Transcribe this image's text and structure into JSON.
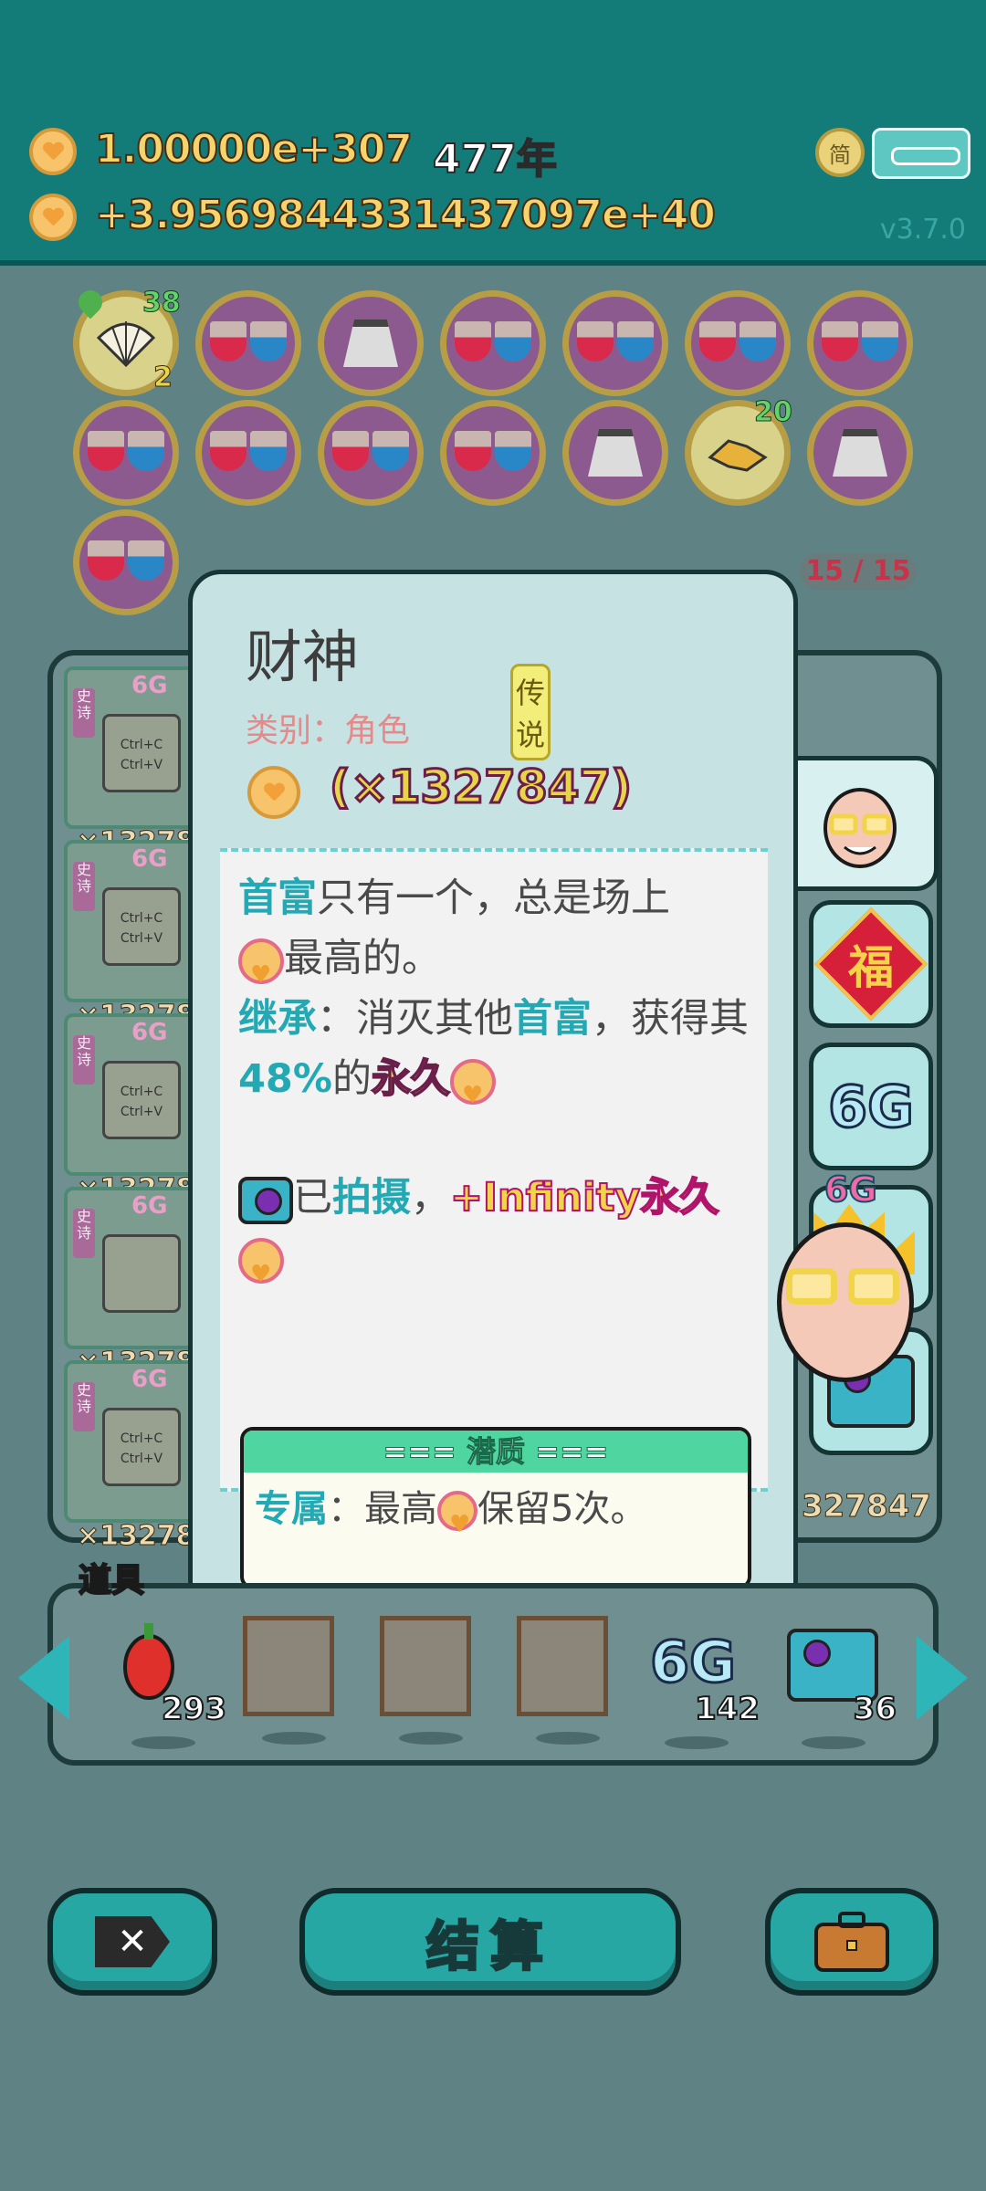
{
  "top": {
    "gold_total": "1.00000e+307",
    "year": "477年",
    "gold_rate": "+3.9569844331437097e+40",
    "lang_button": "简",
    "version": "v3.7.0"
  },
  "badges": {
    "row1_counts": [
      "38",
      "2"
    ],
    "row2_count": "20",
    "slots": "15 / 15"
  },
  "cards": [
    {
      "tag": "史诗",
      "label": "6G",
      "box": "Ctrl+C\nCtrl+V",
      "mult": "×13278"
    },
    {
      "tag": "史诗",
      "label": "6G",
      "box": "Ctrl+C\nCtrl+V",
      "mult": "×13278"
    },
    {
      "tag": "史诗",
      "label": "6G",
      "box": "Ctrl+C\nCtrl+V",
      "mult": "×13278"
    },
    {
      "tag": "史诗",
      "label": "6G",
      "box": "",
      "mult": "×13278"
    },
    {
      "tag": "史诗",
      "label": "6G",
      "box": "Ctrl+C\nCtrl+V",
      "mult": "×13278"
    }
  ],
  "right_col_mult": "327847",
  "popup": {
    "name": "财神",
    "category": "类别：角色",
    "rarity": "传说",
    "crown_label": "6G",
    "multiplier": "(×1327847)",
    "desc1_kw": "首富",
    "desc1_rest": "只有一个，总是场上",
    "desc1_end": "最高的。",
    "desc2_kw": "继承",
    "desc2_a": "：消灭其他",
    "desc2_kw2": "首富",
    "desc2_b": "，获得其",
    "desc2_pct": "48%",
    "desc2_c": "的",
    "desc2_perm": "永久",
    "desc3_a": "已",
    "desc3_kw": "拍摄",
    "desc3_b": "，",
    "desc3_c": "+Infinity永久",
    "potential_header": "=== 潜质 ===",
    "potential_kw": "专属",
    "potential_a": "：最高",
    "potential_b": "保留5次。"
  },
  "right_tabs": [
    "福",
    "6G"
  ],
  "items": {
    "label": "道具",
    "counts": [
      "293",
      "142",
      "36"
    ],
    "six_g": "6G"
  },
  "buttons": {
    "settle": "结算"
  }
}
